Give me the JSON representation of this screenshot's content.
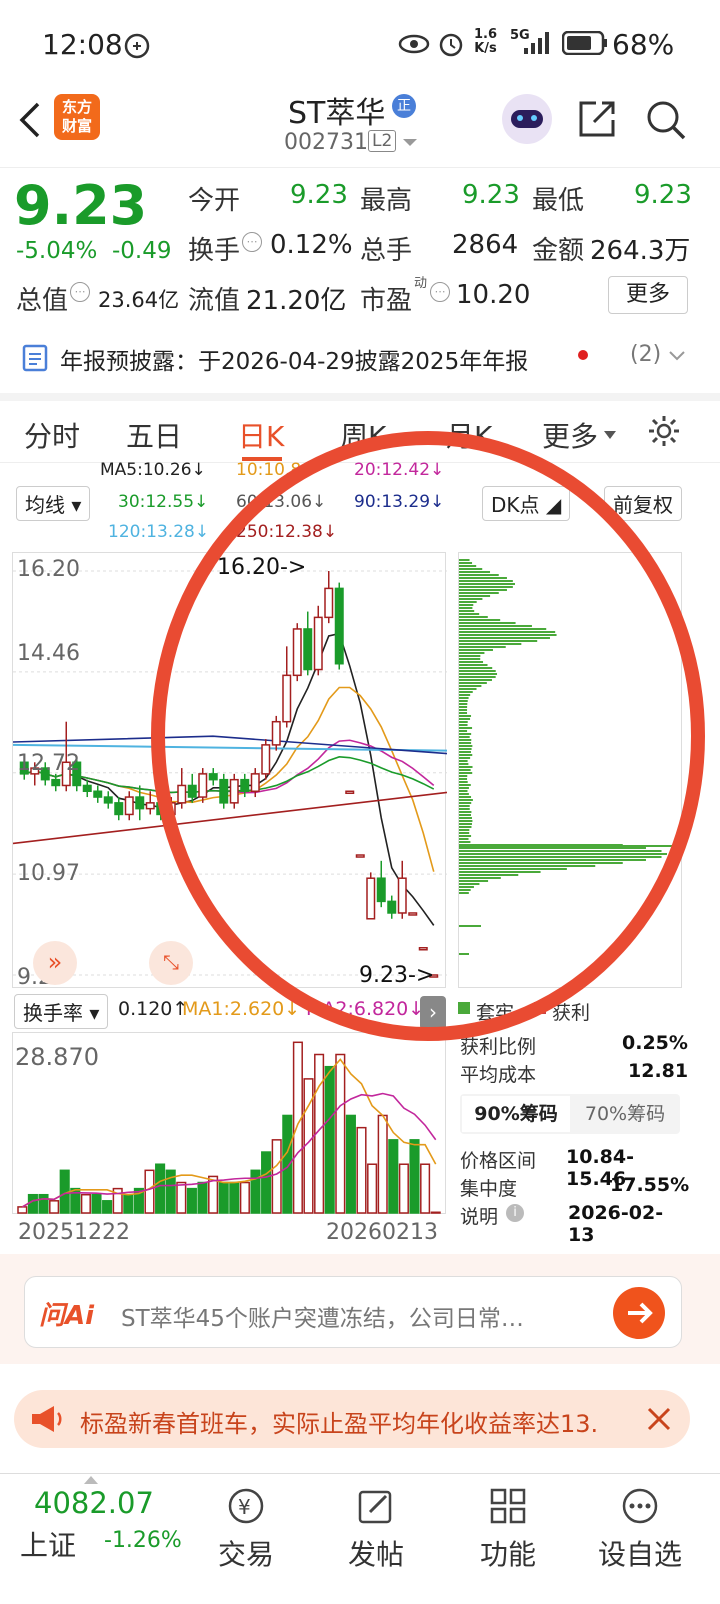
{
  "status": {
    "time": "12:08",
    "net_speed_top": "1.6",
    "net_speed_bottom": "K/s",
    "signal": "5G",
    "battery": "68%"
  },
  "header": {
    "logo_top": "东方",
    "logo_bottom": "财富",
    "title": "ST萃华",
    "badge": "正",
    "code": "002731",
    "level": "L2"
  },
  "quote": {
    "price": "9.23",
    "change_pct": "-5.04%",
    "change": "-0.49",
    "f1": [
      {
        "l": "今开",
        "v": "9.23"
      },
      {
        "l": "最高",
        "v": "9.23"
      },
      {
        "l": "最低",
        "v": "9.23"
      }
    ],
    "turnover_l": "换手",
    "turnover_v": "0.12%",
    "vol_l": "总手",
    "vol_v": "2864",
    "amt_l": "金额",
    "amt_v": "264.3万",
    "mcap_l": "总值",
    "mcap_v": "23.64亿",
    "float_l": "流值",
    "float_v": "21.20亿",
    "pe_l": "市盈",
    "pe_sup": "动",
    "pe_v": "10.20",
    "more": "更多"
  },
  "notice": {
    "text": "年报预披露：于2026-04-29披露2025年年报",
    "count": "(2)"
  },
  "tabs": [
    "分时",
    "五日",
    "日K",
    "周K",
    "月K",
    "更多"
  ],
  "ma": {
    "selector": "均线",
    "ma5": "MA5:10.26↓",
    "ma10": "10:10.8↓",
    "ma20": "20:12.42↓",
    "ma30": "30:12.55↓",
    "ma60": "60:13.06↓",
    "ma90": "90:13.29↓",
    "ma120": "120:13.28↓",
    "ma250": "250:12.38↓",
    "dk": "DK点",
    "fq": "前复权"
  },
  "kline": {
    "y_labels": [
      "16.20",
      "14.46",
      "12.72",
      "10.97",
      "9.23"
    ],
    "high_mark": "16.20->",
    "low_mark": "9.23->"
  },
  "turnover_panel": {
    "selector": "换手率",
    "v": "0.120↑",
    "ma1": "MA1:2.620↓",
    "ma2": "MA2:6.820↓",
    "ymax": "28.870",
    "d1": "20251222",
    "d2": "20260213"
  },
  "chips": {
    "legend_a": "套牢",
    "legend_b": "获利",
    "rows1": [
      {
        "l": "获利比例",
        "v": "0.25%"
      },
      {
        "l": "平均成本",
        "v": "12.81"
      }
    ],
    "tab90": "90%筹码",
    "tab70": "70%筹码",
    "rows2": [
      {
        "l": "价格区间",
        "v": "10.84-15.46"
      },
      {
        "l": "集中度",
        "v": "17.55%"
      },
      {
        "l": "说明",
        "v": "2026-02-13"
      }
    ]
  },
  "ai": {
    "brand": "问Ai",
    "text": "ST萃华45个账户突遭冻结，公司日常…"
  },
  "banner": {
    "text": "标盈新春首班车，实际止盈平均年化收益率达13."
  },
  "bottom": {
    "index_value": "4082.07",
    "index_name": "上证",
    "index_change": "-1.26%",
    "items": [
      "交易",
      "发帖",
      "功能",
      "设自选"
    ]
  },
  "colors": {
    "green": "#1a9b2a",
    "red": "#a31f1f",
    "accent": "#e8512a"
  },
  "chart_data": [
    {
      "type": "candlestick",
      "title": "日K",
      "ylim": [
        9.23,
        16.2
      ],
      "y_ticks": [
        16.2,
        14.46,
        12.72,
        10.97,
        9.23
      ],
      "candles": [
        [
          12.9,
          12.7,
          13.0,
          12.6
        ],
        [
          12.7,
          12.8,
          12.9,
          12.5
        ],
        [
          12.8,
          12.6,
          12.9,
          12.5
        ],
        [
          12.6,
          12.5,
          12.7,
          12.4
        ],
        [
          12.5,
          12.9,
          13.6,
          12.4
        ],
        [
          12.9,
          12.5,
          13.0,
          12.4
        ],
        [
          12.5,
          12.4,
          12.6,
          12.3
        ],
        [
          12.4,
          12.3,
          12.5,
          12.2
        ],
        [
          12.3,
          12.2,
          12.4,
          12.1
        ],
        [
          12.2,
          12.0,
          12.3,
          11.9
        ],
        [
          12.0,
          12.3,
          12.4,
          11.9
        ],
        [
          12.3,
          12.1,
          12.5,
          11.9
        ],
        [
          12.1,
          12.2,
          12.4,
          12.0
        ],
        [
          12.2,
          12.0,
          12.3,
          11.9
        ],
        [
          12.0,
          12.2,
          12.3,
          11.9
        ],
        [
          12.2,
          12.5,
          12.8,
          12.1
        ],
        [
          12.5,
          12.3,
          12.7,
          12.2
        ],
        [
          12.3,
          12.7,
          12.8,
          12.2
        ],
        [
          12.7,
          12.6,
          12.8,
          12.5
        ],
        [
          12.6,
          12.2,
          12.7,
          12.1
        ],
        [
          12.2,
          12.6,
          12.7,
          12.1
        ],
        [
          12.6,
          12.4,
          12.7,
          12.3
        ],
        [
          12.4,
          12.7,
          12.8,
          12.3
        ],
        [
          12.7,
          13.2,
          13.3,
          12.6
        ],
        [
          13.2,
          13.6,
          13.7,
          13.1
        ],
        [
          13.6,
          14.4,
          14.9,
          13.5
        ],
        [
          14.4,
          15.2,
          15.3,
          14.3
        ],
        [
          15.2,
          14.5,
          15.5,
          14.4
        ],
        [
          14.5,
          15.4,
          15.6,
          14.4
        ],
        [
          15.4,
          15.9,
          16.2,
          15.3
        ],
        [
          15.9,
          14.6,
          16.0,
          14.5
        ],
        [
          12.4,
          12.4,
          12.4,
          12.4
        ],
        [
          11.3,
          11.3,
          11.3,
          11.3
        ],
        [
          10.2,
          10.9,
          11.0,
          10.2
        ],
        [
          10.9,
          10.5,
          11.2,
          10.4
        ],
        [
          10.5,
          10.3,
          10.6,
          10.2
        ],
        [
          10.3,
          10.9,
          11.2,
          10.2
        ],
        [
          10.3,
          10.3,
          10.3,
          10.3
        ],
        [
          9.7,
          9.7,
          9.7,
          9.7
        ],
        [
          9.23,
          9.23,
          9.23,
          9.23
        ]
      ]
    },
    {
      "type": "bar",
      "title": "换手率",
      "ylim": [
        0,
        28.87
      ],
      "values": [
        1,
        3,
        3,
        2,
        7,
        4,
        3,
        3,
        2,
        4,
        3,
        4,
        7,
        8,
        7,
        5,
        4,
        5,
        6,
        5,
        5,
        5,
        7,
        10,
        12,
        16,
        28,
        22,
        26,
        24,
        26,
        16,
        14,
        8,
        16,
        12,
        8,
        12,
        8,
        0.12
      ]
    }
  ]
}
